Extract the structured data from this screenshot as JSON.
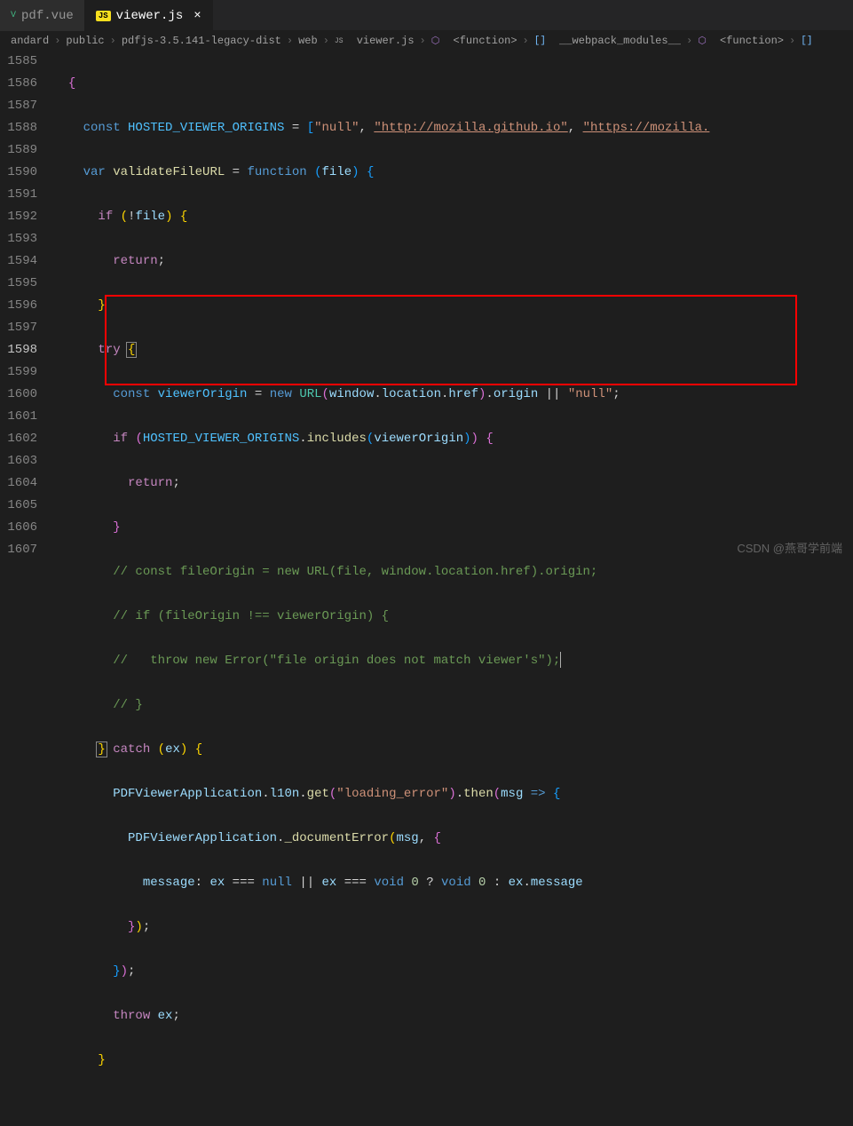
{
  "tabs": [
    {
      "label": "pdf.vue",
      "icon": "V"
    },
    {
      "label": "viewer.js",
      "icon": "JS",
      "active": true
    }
  ],
  "breadcrumbs": {
    "items": [
      "andard",
      "public",
      "pdfjs-3.5.141-legacy-dist",
      "web",
      "viewer.js",
      "<function>",
      "__webpack_modules__",
      "<function>"
    ]
  },
  "gutter_start": 1585,
  "gutter_end": 1607,
  "current_line": 1598,
  "code": {
    "l1585": {
      "brace": "{"
    },
    "l1586": {
      "kw": "const",
      "name": "HOSTED_VIEWER_ORIGINS",
      "eq": " = ",
      "str1": "\"null\"",
      "str2": "\"http://mozilla.github.io\"",
      "str3": "\"https://mozilla."
    },
    "l1587": {
      "kw": "var",
      "fn": "validateFileURL",
      "eq": " = ",
      "kw2": "function",
      "param": "file"
    },
    "l1588": {
      "kw": "if",
      "op": "!",
      "var": "file"
    },
    "l1589": {
      "kw": "return"
    },
    "l1590": {
      "brace": "}"
    },
    "l1591": {
      "kw": "try"
    },
    "l1592": {
      "kw": "const",
      "name": "viewerOrigin",
      "eq": " = ",
      "kw2": "new",
      "cls": "URL",
      "var1": "window",
      "prop1": "location",
      "prop2": "href",
      "prop3": "origin",
      "op": "||",
      "str": "\"null\""
    },
    "l1593": {
      "kw": "if",
      "var": "HOSTED_VIEWER_ORIGINS",
      "fn": "includes",
      "param": "viewerOrigin"
    },
    "l1594": {
      "kw": "return"
    },
    "l1595": {
      "brace": "}"
    },
    "l1596": {
      "text": "// const fileOrigin = new URL(file, window.location.href).origin;"
    },
    "l1597": {
      "text": "// if (fileOrigin !== viewerOrigin) {"
    },
    "l1598": {
      "text": "//   throw new Error(\"file origin does not match viewer's\");"
    },
    "l1599": {
      "text": "// }"
    },
    "l1600": {
      "kw": "catch",
      "param": "ex"
    },
    "l1601": {
      "var": "PDFViewerApplication",
      "prop": "l10n",
      "fn1": "get",
      "str": "\"loading_error\"",
      "fn2": "then",
      "param": "msg"
    },
    "l1602": {
      "var": "PDFViewerApplication",
      "fn": "_documentError",
      "param": "msg"
    },
    "l1603": {
      "prop1": "message",
      "var1": "ex",
      "op1": "===",
      "kw1": "null",
      "op2": "||",
      "var2": "ex",
      "op3": "===",
      "kw2": "void",
      "num1": "0",
      "op4": "?",
      "kw3": "void",
      "num2": "0",
      "op5": ":",
      "var3": "ex",
      "prop2": "message"
    },
    "l1604": {
      "brace": "});"
    },
    "l1605": {
      "brace": "});"
    },
    "l1606": {
      "kw": "throw",
      "var": "ex"
    },
    "l1607": {
      "brace": "}"
    }
  },
  "watermark": "CSDN @燕哥学前端"
}
